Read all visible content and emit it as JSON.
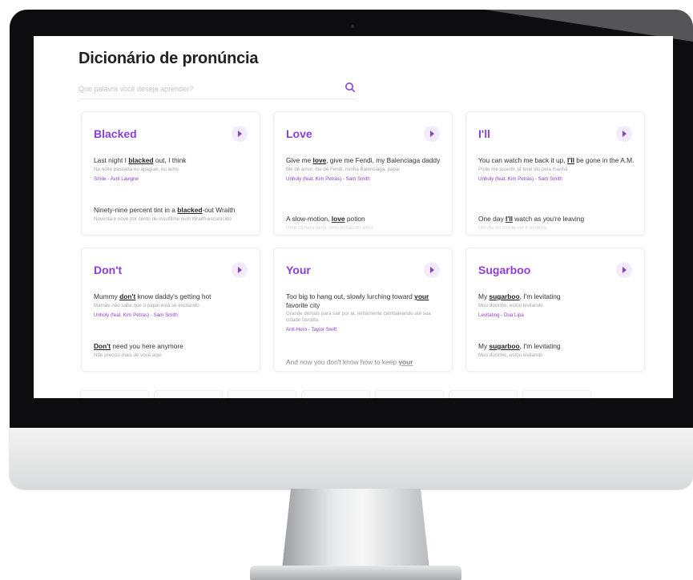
{
  "page": {
    "title": "Dicionário de pronúncia",
    "search_placeholder": "Que palavra você deseja aprender?"
  },
  "colors": {
    "accent": "#8d3ed6",
    "play_bg": "#f4ecfc"
  },
  "icons": {
    "search": "search-icon",
    "play": "play-icon"
  },
  "cards": [
    {
      "word": "Blacked",
      "examples": [
        {
          "before": "Last night I ",
          "highlight": "blacked",
          "after": " out, I think",
          "translation": "Na noite passada eu apaguei, eu acho",
          "source": "Smile - Avril Lavigne"
        },
        {
          "before": "Ninety-nine percent tint in a ",
          "highlight": "blacked",
          "after": "-out Wraith",
          "translation": "Noventa e nove por cento de insulfilme num Wraith escurecido",
          "source": ""
        }
      ]
    },
    {
      "word": "Love",
      "examples": [
        {
          "before": "Give me ",
          "highlight": "love",
          "after": ", give me Fendi, my Balenciaga daddy",
          "translation": "Me dê amor, me dê Fendi, minha Balenciaga, papai",
          "source": "Unholy (feat. Kim Petras) - Sam Smith"
        },
        {
          "before": "A slow-motion, ",
          "highlight": "love",
          "after": " potion",
          "translation": "Uma câmera lenta, uma poção do amor",
          "source": ""
        }
      ]
    },
    {
      "word": "I'll",
      "examples": [
        {
          "before": "You can watch me back it up, ",
          "highlight": "I'll",
          "after": " be gone in the A.M.",
          "translation": "Pode me assistir, já terei ido pela manhã",
          "source": "Unholy (feat. Kim Petras) - Sam Smith"
        },
        {
          "before": "One day ",
          "highlight": "I'll",
          "after": " watch as you're leaving",
          "translation": "Um dia eu vou te ver ir embora",
          "source": ""
        }
      ]
    },
    {
      "word": "Don't",
      "examples": [
        {
          "before": "Mummy ",
          "highlight": "don't",
          "after": " know daddy's getting hot",
          "translation": "Mamãe não sabe que o papai está se excitando",
          "source": "Unholy (feat. Kim Petras) - Sam Smith"
        },
        {
          "before": "",
          "highlight": "Don't",
          "after": " need you here anymore",
          "translation": "Não preciso mais de você aqui",
          "source": ""
        }
      ]
    },
    {
      "word": "Your",
      "examples": [
        {
          "before": "Too big to hang out, slowly lurching toward ",
          "highlight": "your",
          "after": " favorite city",
          "translation": "Grande demais para sair por aí, lentamente cambaleando até sua cidade favorita",
          "source": "Anti-Hero - Taylor Swift"
        },
        {
          "before": "And now you don't know how to keep ",
          "highlight": "your",
          "after": "",
          "translation": "",
          "source": ""
        }
      ]
    },
    {
      "word": "Sugarboo",
      "examples": [
        {
          "before": "My ",
          "highlight": "sugarboo",
          "after": ", I'm levitating",
          "translation": "Meu docinho, estou levitando",
          "source": "Levitating - Dua Lipa"
        },
        {
          "before": "My ",
          "highlight": "sugarboo",
          "after": ", I'm levitating",
          "translation": "Meu docinho, estou levitando",
          "source": ""
        }
      ]
    }
  ]
}
